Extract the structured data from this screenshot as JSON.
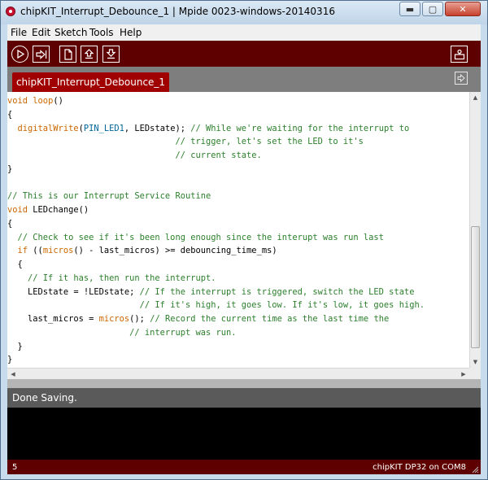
{
  "window": {
    "title": "chipKIT_Interrupt_Debounce_1 | Mpide 0023-windows-20140316",
    "minimize_symbol": "▬",
    "maximize_symbol": "▢",
    "close_symbol": "✕"
  },
  "menu": [
    "File",
    "Edit",
    "Sketch",
    "Tools",
    "Help"
  ],
  "toolbar": {
    "buttons": [
      "verify-icon",
      "upload-icon",
      "new-icon",
      "open-icon",
      "save-icon"
    ],
    "right_button": "serial-monitor-icon"
  },
  "tabs": [
    {
      "label": "chipKIT_Interrupt_Debounce_1"
    }
  ],
  "tab_menu_icon": "tab-menu-arrow-icon",
  "code_lines": [
    {
      "parts": [
        {
          "t": "void",
          "c": "kw"
        },
        {
          "t": " "
        },
        {
          "t": "loop",
          "c": "fn"
        },
        {
          "t": "()"
        }
      ]
    },
    {
      "parts": [
        {
          "t": "{"
        }
      ]
    },
    {
      "parts": [
        {
          "t": "  "
        },
        {
          "t": "digitalWrite",
          "c": "fn"
        },
        {
          "t": "("
        },
        {
          "t": "PIN_LED1",
          "c": "const"
        },
        {
          "t": ", LEDstate); "
        },
        {
          "t": "// While we're waiting for the interrupt to",
          "c": "cm"
        }
      ]
    },
    {
      "parts": [
        {
          "t": "                                 "
        },
        {
          "t": "// trigger, let's set the LED to it's",
          "c": "cm"
        }
      ]
    },
    {
      "parts": [
        {
          "t": "                                 "
        },
        {
          "t": "// current state.",
          "c": "cm"
        }
      ]
    },
    {
      "parts": [
        {
          "t": "}"
        }
      ]
    },
    {
      "parts": [
        {
          "t": ""
        }
      ]
    },
    {
      "parts": [
        {
          "t": "// This is our Interrupt Service Routine",
          "c": "cm"
        }
      ]
    },
    {
      "parts": [
        {
          "t": "void",
          "c": "kw"
        },
        {
          "t": " LEDchange()"
        }
      ]
    },
    {
      "parts": [
        {
          "t": "{"
        }
      ]
    },
    {
      "parts": [
        {
          "t": "  "
        },
        {
          "t": "// Check to see if it's been long enough since the interupt was run last",
          "c": "cm"
        }
      ]
    },
    {
      "parts": [
        {
          "t": "  "
        },
        {
          "t": "if",
          "c": "kw"
        },
        {
          "t": " (("
        },
        {
          "t": "micros",
          "c": "fn"
        },
        {
          "t": "() - last_micros) >= debouncing_time_ms)"
        }
      ]
    },
    {
      "parts": [
        {
          "t": "  {"
        }
      ]
    },
    {
      "parts": [
        {
          "t": "    "
        },
        {
          "t": "// If it has, then run the interrupt.",
          "c": "cm"
        }
      ]
    },
    {
      "parts": [
        {
          "t": "    LEDstate = !LEDstate; "
        },
        {
          "t": "// If the interrupt is triggered, switch the LED state",
          "c": "cm"
        }
      ]
    },
    {
      "parts": [
        {
          "t": "                          "
        },
        {
          "t": "// If it's high, it goes low. If it's low, it goes high.",
          "c": "cm"
        }
      ]
    },
    {
      "parts": [
        {
          "t": "    last_micros = "
        },
        {
          "t": "micros",
          "c": "fn"
        },
        {
          "t": "(); "
        },
        {
          "t": "// Record the current time as the last time the",
          "c": "cm"
        }
      ]
    },
    {
      "parts": [
        {
          "t": "                        "
        },
        {
          "t": "// interrupt was run.",
          "c": "cm"
        }
      ]
    },
    {
      "parts": [
        {
          "t": "  }"
        }
      ]
    },
    {
      "parts": [
        {
          "t": "}"
        }
      ]
    }
  ],
  "status": {
    "message": "Done Saving."
  },
  "footer": {
    "line_number": "5",
    "board": "chipKIT DP32 on COM8"
  },
  "colors": {
    "toolbar_bg": "#5e0000",
    "tab_active": "#a10000",
    "keyword": "#cc6600",
    "constant": "#006699",
    "comment": "#2b7f2b"
  }
}
